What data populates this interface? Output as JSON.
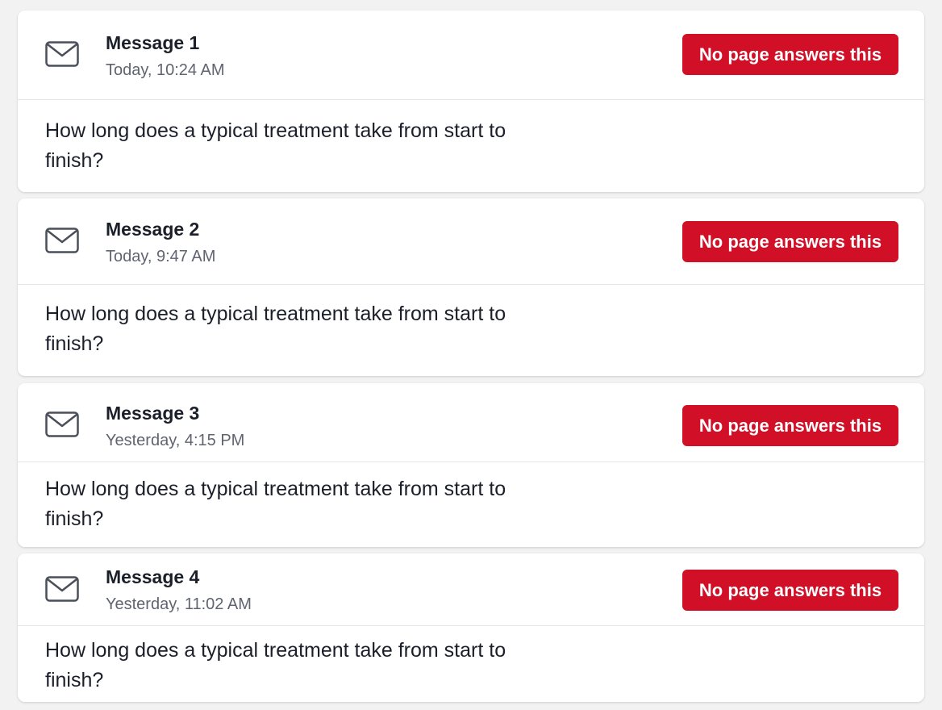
{
  "messages": [
    {
      "title": "Message 1",
      "timestamp": "Today, 10:24 AM",
      "badge": "No page answers this",
      "question": "How long does a typical treatment take from start to finish?",
      "icon": "mail-icon"
    },
    {
      "title": "Message 2",
      "timestamp": "Today, 9:47 AM",
      "badge": "No page answers this",
      "question": "How long does a typical treatment take from start to finish?",
      "icon": "mail-icon"
    },
    {
      "title": "Message 3",
      "timestamp": "Yesterday, 4:15 PM",
      "badge": "No page answers this",
      "question": "How long does a typical treatment take from start to finish?",
      "icon": "mail-icon"
    },
    {
      "title": "Message 4",
      "timestamp": "Yesterday, 11:02 AM",
      "badge": "No page answers this",
      "question": "How long does a typical treatment take from start to finish?",
      "icon": "mail-icon"
    }
  ],
  "colors": {
    "badge_bg": "#d10f26",
    "badge_text": "#ffffff",
    "title_text": "#1b1f2a",
    "timestamp_text": "#5f6470",
    "page_bg": "#f2f2f2"
  }
}
